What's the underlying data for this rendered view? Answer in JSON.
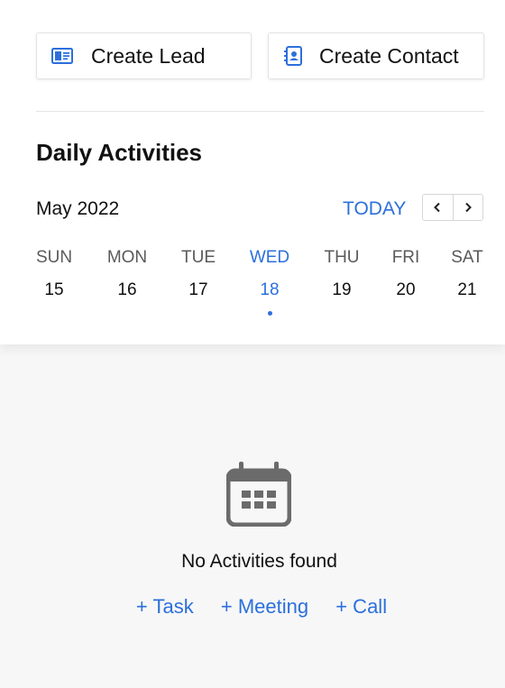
{
  "actions": {
    "create_lead": "Create Lead",
    "create_contact": "Create Contact"
  },
  "activities": {
    "title": "Daily Activities",
    "month": "May 2022",
    "today_label": "TODAY",
    "days": [
      {
        "name": "SUN",
        "num": "15"
      },
      {
        "name": "MON",
        "num": "16"
      },
      {
        "name": "TUE",
        "num": "17"
      },
      {
        "name": "WED",
        "num": "18"
      },
      {
        "name": "THU",
        "num": "19"
      },
      {
        "name": "FRI",
        "num": "20"
      },
      {
        "name": "SAT",
        "num": "21"
      }
    ],
    "selected_day": "WED"
  },
  "empty_state": {
    "icon": "calendar-icon",
    "message": "No Activities found",
    "links": [
      "+ Task",
      "+ Meeting",
      "+ Call"
    ]
  },
  "colors": {
    "accent": "#2c6fdc",
    "icon_gray": "#6b6b6b"
  }
}
